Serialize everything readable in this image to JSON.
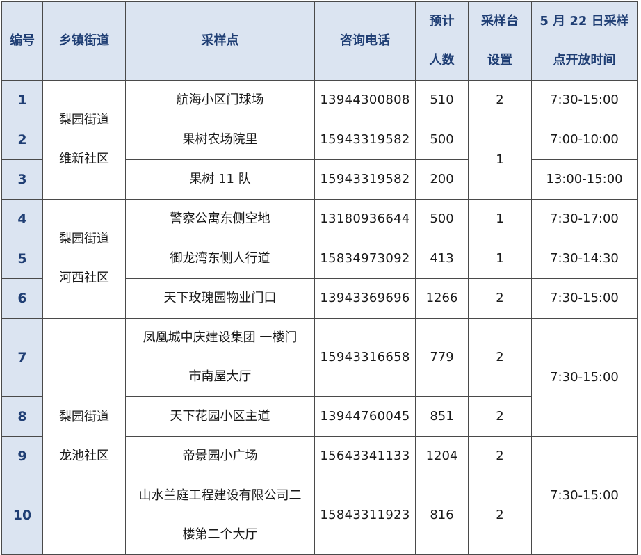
{
  "header": {
    "id": "编号",
    "street": "乡镇街道",
    "site": "采样点",
    "phone": "咨询电话",
    "expected_l1": "预计",
    "expected_l2": "人数",
    "stations_l1": "采样台",
    "stations_l2": "设置",
    "hours_l1": "5 月 22 日采样",
    "hours_l2": "点开放时间"
  },
  "groups": [
    {
      "street": "梨园街道",
      "community": "维新社区"
    },
    {
      "street": "梨园街道",
      "community": "河西社区"
    },
    {
      "street": "梨园街道",
      "community": "龙池社区"
    }
  ],
  "rows": [
    {
      "id": "1",
      "site": "航海小区门球场",
      "phone": "13944300808",
      "expected": "510",
      "stations": "2",
      "hours": "7:30-15:00"
    },
    {
      "id": "2",
      "site": "果树农场院里",
      "phone": "15943319582",
      "expected": "500",
      "stations": "1",
      "hours": "7:00-10:00"
    },
    {
      "id": "3",
      "site": "果树 11 队",
      "phone": "15943319582",
      "expected": "200",
      "stations": "",
      "hours": "13:00-15:00"
    },
    {
      "id": "4",
      "site": "警察公寓东侧空地",
      "phone": "13180936644",
      "expected": "500",
      "stations": "1",
      "hours": "7:30-17:00"
    },
    {
      "id": "5",
      "site": "御龙湾东侧人行道",
      "phone": "15834973092",
      "expected": "413",
      "stations": "1",
      "hours": "7:30-14:30"
    },
    {
      "id": "6",
      "site": "天下玫瑰园物业门口",
      "phone": "13943369696",
      "expected": "1266",
      "stations": "2",
      "hours": "7:30-15:00"
    },
    {
      "id": "7",
      "site_l1": "凤凰城中庆建设集团 一楼门",
      "site_l2": "市南屋大厅",
      "phone": "15943316658",
      "expected": "779",
      "stations": "2",
      "hours": "7:30-15:00"
    },
    {
      "id": "8",
      "site": "天下花园小区主道",
      "phone": "13944760045",
      "expected": "851",
      "stations": "2",
      "hours": ""
    },
    {
      "id": "9",
      "site": "帝景园小广场",
      "phone": "15643341133",
      "expected": "1204",
      "stations": "2",
      "hours": "7:30-15:00"
    },
    {
      "id": "10",
      "site_l1": "山水兰庭工程建设有限公司二",
      "site_l2": "楼第二个大厅",
      "phone": "15843311923",
      "expected": "816",
      "stations": "2",
      "hours": ""
    }
  ]
}
